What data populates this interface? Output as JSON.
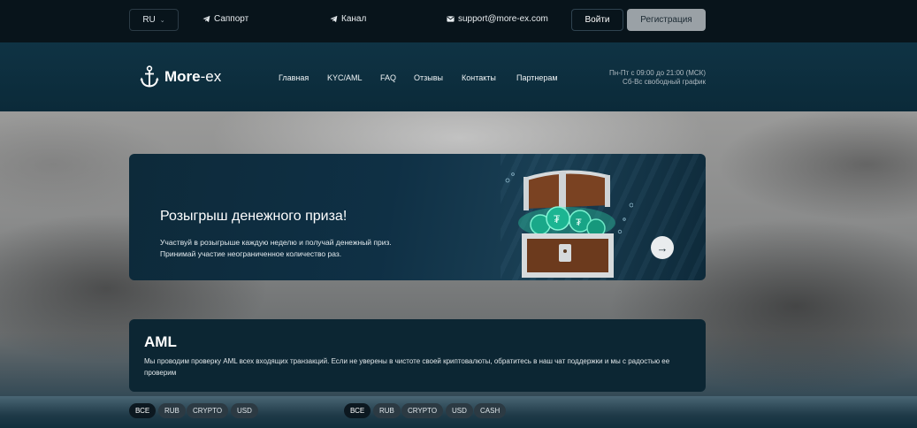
{
  "topbar": {
    "language": "RU",
    "support_label": "Саппорт",
    "channel_label": "Канал",
    "email": "support@more-ex.com",
    "login_label": "Войти",
    "register_label": "Регистрация"
  },
  "brand": {
    "name_bold": "More",
    "name_rest": "-ex"
  },
  "nav": {
    "items": [
      "Главная",
      "KYC/AML",
      "FAQ",
      "Отзывы",
      "Контакты",
      "Партнерам"
    ]
  },
  "hours": {
    "line1": "Пн-Пт с 09:00 до 21:00 (МСК)",
    "line2": "Сб-Вс свободный график"
  },
  "promo": {
    "title": "Розыгрыш денежного приза!",
    "line1": "Участвуй в розыгрыше каждую неделю и получай денежный приз.",
    "line2": "Принимай участие неограниченное количество раз."
  },
  "aml": {
    "title": "AML",
    "text": "Мы проводим проверку AML всех входящих транзакций. Если не уверены в чистоте своей криптовалюты, обратитесь в наш чат поддержки и мы с радостью ее проверим"
  },
  "filters_left": [
    "ВСЕ",
    "RUB",
    "CRYPTO",
    "USD"
  ],
  "filters_right": [
    "ВСЕ",
    "RUB",
    "CRYPTO",
    "USD",
    "CASH"
  ],
  "colors": {
    "topbar_bg": "#08141b",
    "nav_bg": "#0f3344",
    "card_bg": "#0c2633",
    "register_btn": "#9aa1a6"
  }
}
